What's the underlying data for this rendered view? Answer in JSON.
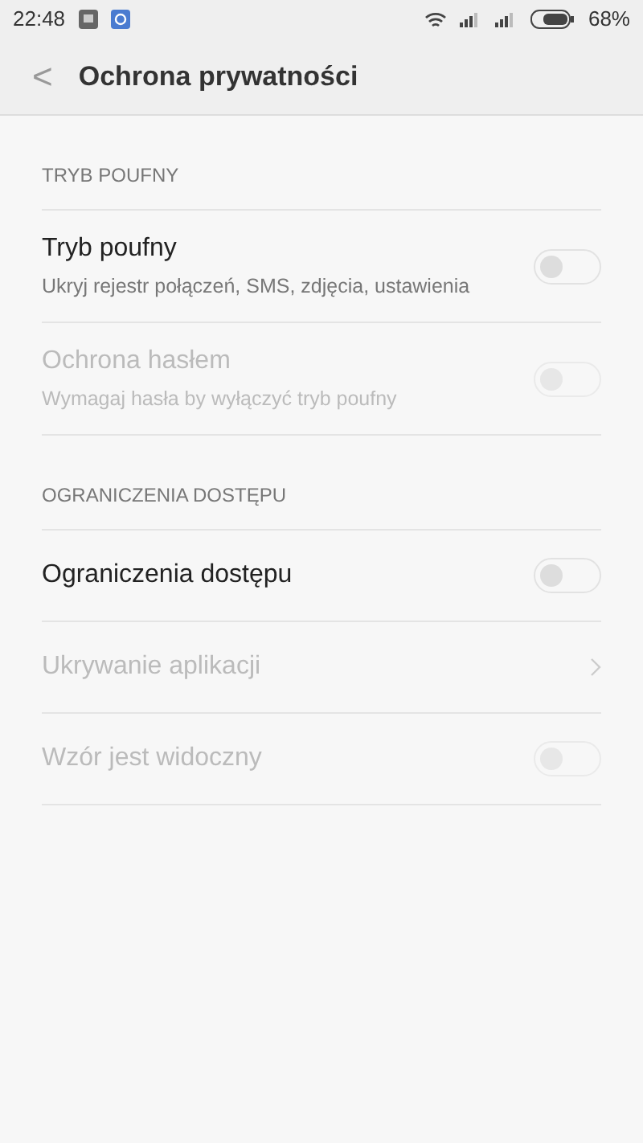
{
  "status_bar": {
    "time": "22:48",
    "battery_text": "68%"
  },
  "header": {
    "back": "<",
    "title": "Ochrona prywatności"
  },
  "sections": [
    {
      "title": "TRYB POUFNY",
      "items": [
        {
          "kind": "toggle",
          "title": "Tryb poufny",
          "subtitle": "Ukryj rejestr połączeń, SMS, zdjęcia, ustawienia",
          "on": false,
          "disabled": false
        },
        {
          "kind": "toggle",
          "title": "Ochrona hasłem",
          "subtitle": "Wymagaj hasła by wyłączyć tryb poufny",
          "on": false,
          "disabled": true
        }
      ]
    },
    {
      "title": "OGRANICZENIA DOSTĘPU",
      "items": [
        {
          "kind": "toggle",
          "title": "Ograniczenia dostępu",
          "on": false,
          "disabled": false
        },
        {
          "kind": "link",
          "title": "Ukrywanie aplikacji",
          "disabled": true
        },
        {
          "kind": "toggle",
          "title": "Wzór jest widoczny",
          "on": false,
          "disabled": true
        }
      ]
    }
  ]
}
